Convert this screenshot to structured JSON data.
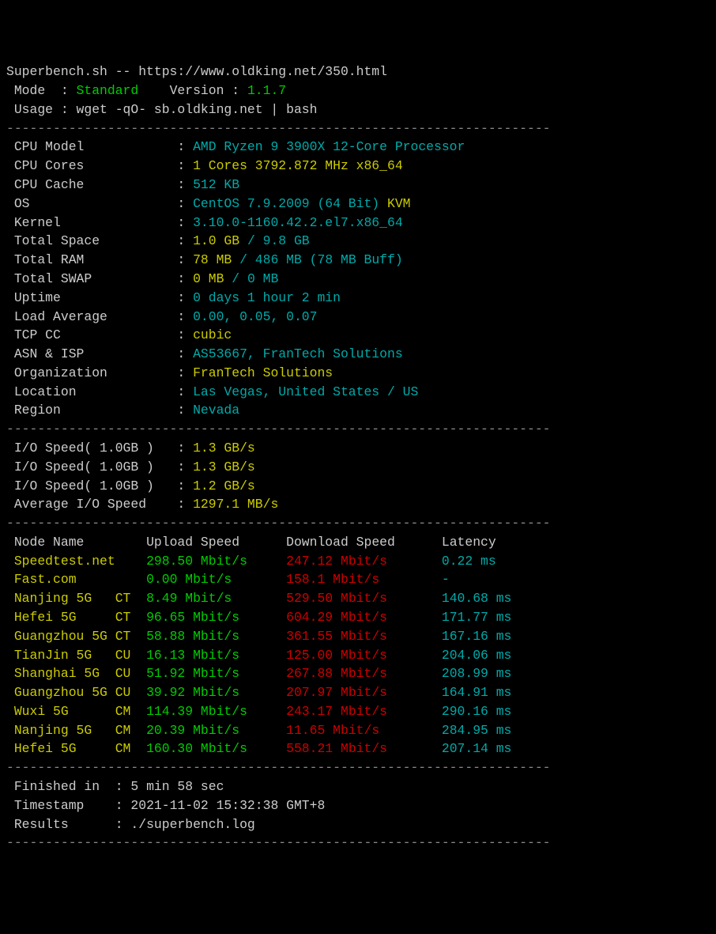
{
  "header": {
    "title": "Superbench.sh -- https://www.oldking.net/350.html",
    "mode_label": " Mode  : ",
    "mode_value": "Standard",
    "version_label": "    Version : ",
    "version_value": "1.1.7",
    "usage_label": " Usage : ",
    "usage_value": "wget -qO- sb.oldking.net | bash"
  },
  "divider": "----------------------------------------------------------------------",
  "sys": {
    "cpu_model_l": " CPU Model            : ",
    "cpu_model_v": "AMD Ryzen 9 3900X 12-Core Processor",
    "cpu_cores_l": " CPU Cores            : ",
    "cpu_cores_v": "1 Cores 3792.872 MHz x86_64",
    "cpu_cache_l": " CPU Cache            : ",
    "cpu_cache_v": "512 KB",
    "os_l": " OS                   : ",
    "os_v": "CentOS 7.9.2009 (64 Bit)",
    "os_kvm": " KVM",
    "kernel_l": " Kernel               : ",
    "kernel_v": "3.10.0-1160.42.2.el7.x86_64",
    "space_l": " Total Space          : ",
    "space_used": "1.0 GB ",
    "space_sep": "/",
    "space_total": " 9.8 GB",
    "ram_l": " Total RAM            : ",
    "ram_used": "78 MB ",
    "ram_sep": "/",
    "ram_total": " 486 MB ",
    "ram_buff": "(78 MB Buff)",
    "swap_l": " Total SWAP           : ",
    "swap_used": "0 MB ",
    "swap_sep": "/",
    "swap_total": " 0 MB",
    "uptime_l": " Uptime               : ",
    "uptime_v": "0 days 1 hour 2 min",
    "load_l": " Load Average         : ",
    "load_v": "0.00, 0.05, 0.07",
    "tcp_l": " TCP CC               : ",
    "tcp_v": "cubic",
    "asn_l": " ASN & ISP            : ",
    "asn_v": "AS53667, FranTech Solutions",
    "org_l": " Organization         : ",
    "org_v": "FranTech Solutions",
    "loc_l": " Location             : ",
    "loc_v": "Las Vegas, United States / US",
    "region_l": " Region               : ",
    "region_v": "Nevada"
  },
  "io": {
    "r1_l": " I/O Speed( 1.0GB )   : ",
    "r1_v": "1.3 GB/s",
    "r2_l": " I/O Speed( 1.0GB )   : ",
    "r2_v": "1.3 GB/s",
    "r3_l": " I/O Speed( 1.0GB )   : ",
    "r3_v": "1.2 GB/s",
    "avg_l": " Average I/O Speed    : ",
    "avg_v": "1297.1 MB/s"
  },
  "speed_header": {
    "node": " Node Name        ",
    "up": "Upload Speed      ",
    "down": "Download Speed      ",
    "lat": "Latency"
  },
  "speed": [
    {
      "node": " Speedtest.net    ",
      "up": "298.50 Mbit/s     ",
      "down": "247.12 Mbit/s       ",
      "lat": "0.22 ms"
    },
    {
      "node": " Fast.com         ",
      "up": "0.00 Mbit/s       ",
      "down": "158.1 Mbit/s        ",
      "lat": "-"
    },
    {
      "node": " Nanjing 5G   CT  ",
      "up": "8.49 Mbit/s       ",
      "down": "529.50 Mbit/s       ",
      "lat": "140.68 ms"
    },
    {
      "node": " Hefei 5G     CT  ",
      "up": "96.65 Mbit/s      ",
      "down": "604.29 Mbit/s       ",
      "lat": "171.77 ms"
    },
    {
      "node": " Guangzhou 5G CT  ",
      "up": "58.88 Mbit/s      ",
      "down": "361.55 Mbit/s       ",
      "lat": "167.16 ms"
    },
    {
      "node": " TianJin 5G   CU  ",
      "up": "16.13 Mbit/s      ",
      "down": "125.00 Mbit/s       ",
      "lat": "204.06 ms"
    },
    {
      "node": " Shanghai 5G  CU  ",
      "up": "51.92 Mbit/s      ",
      "down": "267.88 Mbit/s       ",
      "lat": "208.99 ms"
    },
    {
      "node": " Guangzhou 5G CU  ",
      "up": "39.92 Mbit/s      ",
      "down": "207.97 Mbit/s       ",
      "lat": "164.91 ms"
    },
    {
      "node": " Wuxi 5G      CM  ",
      "up": "114.39 Mbit/s     ",
      "down": "243.17 Mbit/s       ",
      "lat": "290.16 ms"
    },
    {
      "node": " Nanjing 5G   CM  ",
      "up": "20.39 Mbit/s      ",
      "down": "11.65 Mbit/s        ",
      "lat": "284.95 ms"
    },
    {
      "node": " Hefei 5G     CM  ",
      "up": "160.30 Mbit/s     ",
      "down": "558.21 Mbit/s       ",
      "lat": "207.14 ms"
    }
  ],
  "footer": {
    "finished_l": " Finished in  : ",
    "finished_v": "5 min 58 sec",
    "ts_l": " Timestamp    : ",
    "ts_v": "2021-11-02 15:32:38 GMT+8",
    "res_l": " Results      : ",
    "res_v": "./superbench.log"
  }
}
